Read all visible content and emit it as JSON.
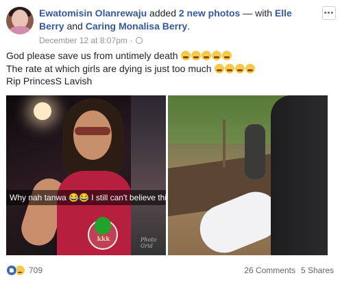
{
  "author": {
    "name": "Ewatomisin Olanrewaju",
    "action_pre": "added",
    "photos_link": "2 new photos",
    "action_mid": "— with",
    "tag1": "Elle Berry",
    "and": "and",
    "tag2": "Caring Monalisa Berry",
    "period": ".",
    "timestamp": "December 12 at 8:07pm",
    "separator": "·",
    "privacy_icon": "globe-icon"
  },
  "menu_label": "•••",
  "post_text": {
    "line1": "God please save us from untimely death",
    "line2": "The rate at which girls are dying is just too much",
    "line3": "Rip PrincesS Lavish"
  },
  "photo_left": {
    "caption": "Why nah tanwa 😂😂 I still can't believe this oo",
    "logo_text": "kkk",
    "watermark": "Photo Grid"
  },
  "reactions": {
    "icons": [
      "like-icon",
      "sad-icon"
    ],
    "count": "709",
    "comments": "26 Comments",
    "shares": "5 Shares"
  },
  "colors": {
    "link": "#365899",
    "meta": "#90949c",
    "like": "#4267b2"
  }
}
